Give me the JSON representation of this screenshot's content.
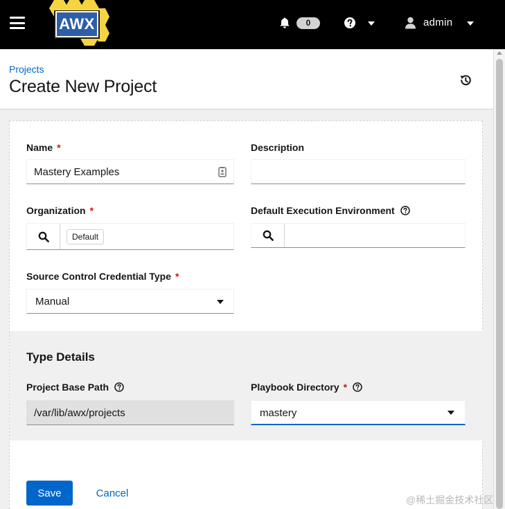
{
  "header": {
    "logo_text": "AWX",
    "notification_count": "0",
    "username": "admin",
    "colors": {
      "background": "#000000",
      "logo_hex": "#f5d442",
      "logo_badge": "#2e5ea8"
    }
  },
  "page": {
    "breadcrumb": "Projects",
    "title": "Create New Project"
  },
  "form": {
    "name": {
      "label": "Name",
      "required": "*",
      "value": "Mastery Examples"
    },
    "description": {
      "label": "Description",
      "value": ""
    },
    "organization": {
      "label": "Organization",
      "required": "*",
      "chip": "Default"
    },
    "execution_environment": {
      "label": "Default Execution Environment",
      "value": ""
    },
    "scm_type": {
      "label": "Source Control Credential Type",
      "required": "*",
      "value": "Manual"
    },
    "type_details": {
      "title": "Type Details",
      "base_path": {
        "label": "Project Base Path",
        "value": "/var/lib/awx/projects"
      },
      "playbook_dir": {
        "label": "Playbook Directory",
        "required": "*",
        "value": "mastery"
      }
    },
    "save_label": "Save",
    "cancel_label": "Cancel"
  },
  "watermark": "@稀土掘金技术社区",
  "colors": {
    "link": "#0066cc",
    "primary": "#0066cc",
    "required": "#c9190b"
  }
}
